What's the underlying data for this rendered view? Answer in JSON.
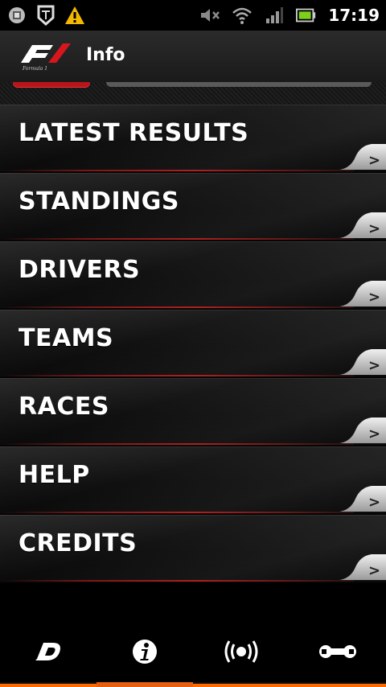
{
  "status_bar": {
    "time": "17:19",
    "icons": [
      "settings-chip-icon",
      "shield-app-icon",
      "warning-icon",
      "mute-icon",
      "wifi-icon",
      "signal-icon",
      "battery-icon"
    ]
  },
  "header": {
    "title": "Info",
    "logo": "f1-logo"
  },
  "menu": {
    "items": [
      {
        "label": "LATEST RESULTS"
      },
      {
        "label": "STANDINGS"
      },
      {
        "label": "DRIVERS"
      },
      {
        "label": "TEAMS"
      },
      {
        "label": "RACES"
      },
      {
        "label": "HELP"
      },
      {
        "label": "CREDITS"
      }
    ],
    "chevron": ">"
  },
  "bottom_nav": {
    "items": [
      {
        "icon": "live-timing-icon",
        "active": false
      },
      {
        "icon": "info-icon",
        "active": true
      },
      {
        "icon": "broadcast-icon",
        "active": false
      },
      {
        "icon": "tools-icon",
        "active": false
      }
    ]
  },
  "colors": {
    "accent": "#e8600f",
    "racing_red": "#b8141a",
    "background": "#000000"
  }
}
